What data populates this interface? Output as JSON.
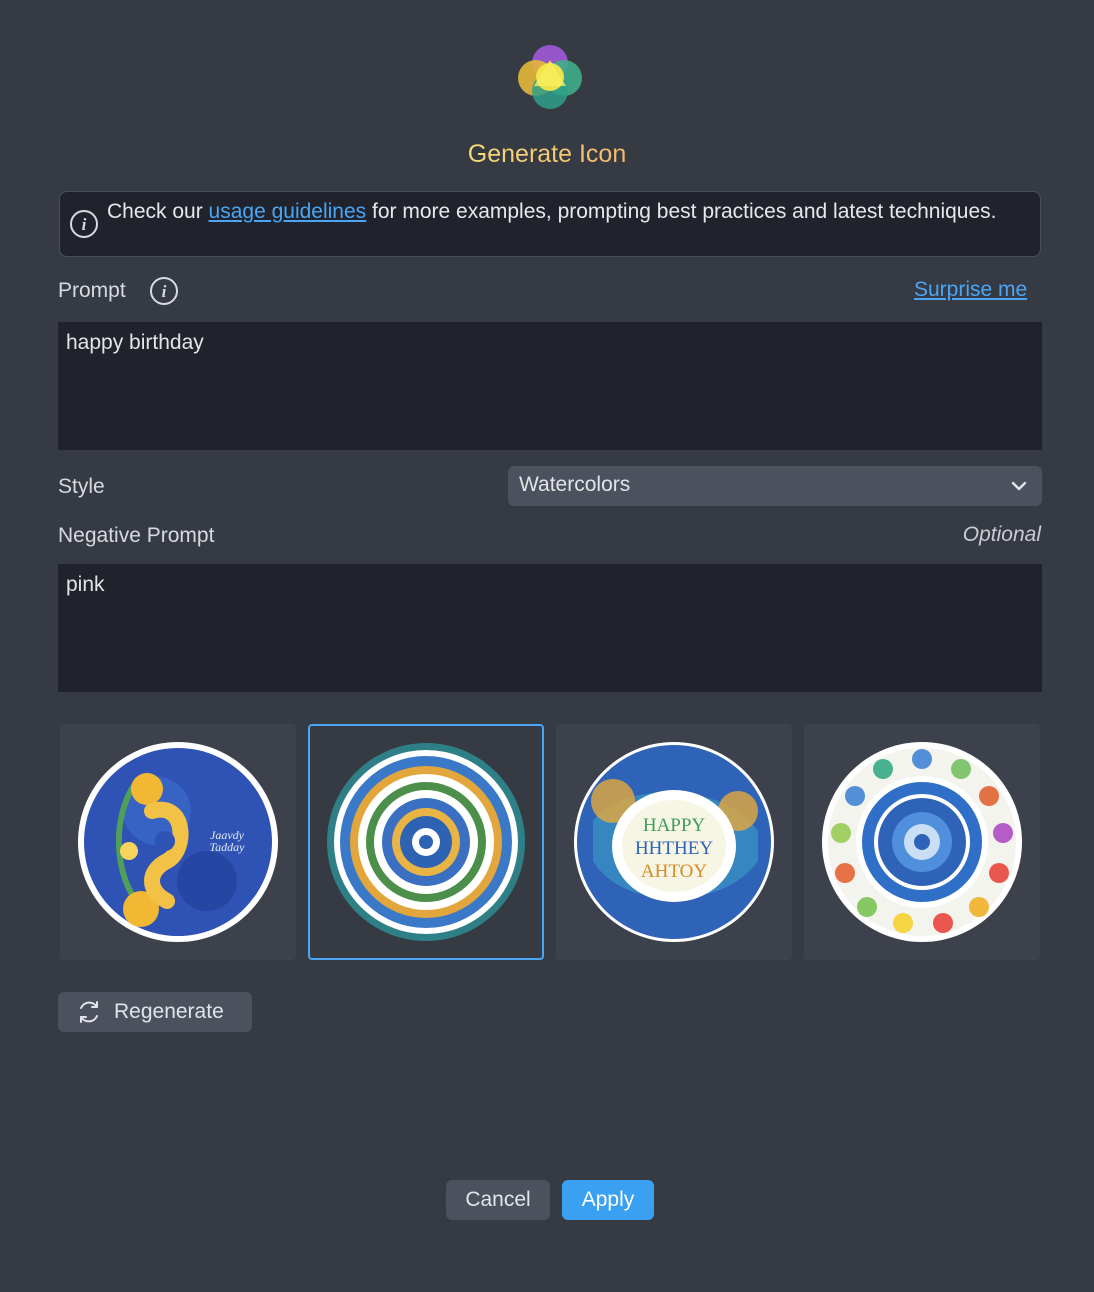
{
  "dialog": {
    "title": "Generate Icon",
    "logo_icon": "ai-generate-logo-icon"
  },
  "info_banner": {
    "prefix": "Check our ",
    "link_text": "usage guidelines",
    "suffix": " for more examples, prompting best practices and latest techniques.",
    "icon": "info-icon"
  },
  "prompt": {
    "label": "Prompt",
    "surprise_label": "Surprise me",
    "value": "happy birthday"
  },
  "style": {
    "label": "Style",
    "selected": "Watercolors"
  },
  "negative_prompt": {
    "label": "Negative Prompt",
    "optional_label": "Optional",
    "value": "pink"
  },
  "results": {
    "selected_index": 1,
    "items": [
      {
        "name": "result-1",
        "selected": false
      },
      {
        "name": "result-2",
        "selected": true
      },
      {
        "name": "result-3",
        "selected": false
      },
      {
        "name": "result-4",
        "selected": false
      }
    ]
  },
  "regenerate": {
    "label": "Regenerate",
    "icon": "refresh-icon"
  },
  "footer": {
    "cancel_label": "Cancel",
    "apply_label": "Apply"
  },
  "colors": {
    "background": "#353a43",
    "field": "#20232b",
    "accent": "#4aa6f5",
    "button": "#4b525d",
    "primary_button": "#3aa0f2"
  }
}
